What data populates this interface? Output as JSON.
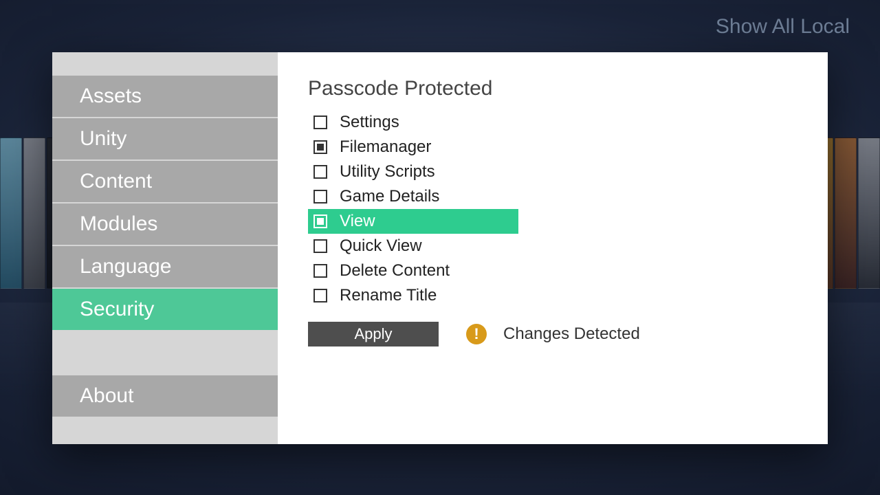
{
  "header": {
    "top_right": "Show All Local"
  },
  "sidebar": {
    "items": [
      {
        "label": "Assets",
        "selected": false
      },
      {
        "label": "Unity",
        "selected": false
      },
      {
        "label": "Content",
        "selected": false
      },
      {
        "label": "Modules",
        "selected": false
      },
      {
        "label": "Language",
        "selected": false
      },
      {
        "label": "Security",
        "selected": true
      }
    ],
    "footer_item": {
      "label": "About",
      "selected": false
    }
  },
  "main": {
    "title": "Passcode Protected",
    "options": [
      {
        "label": "Settings",
        "checked": false,
        "highlighted": false
      },
      {
        "label": "Filemanager",
        "checked": true,
        "highlighted": false
      },
      {
        "label": "Utility Scripts",
        "checked": false,
        "highlighted": false
      },
      {
        "label": "Game Details",
        "checked": false,
        "highlighted": false
      },
      {
        "label": "View",
        "checked": true,
        "highlighted": true
      },
      {
        "label": "Quick View",
        "checked": false,
        "highlighted": false
      },
      {
        "label": "Delete Content",
        "checked": false,
        "highlighted": false
      },
      {
        "label": "Rename Title",
        "checked": false,
        "highlighted": false
      }
    ],
    "apply_label": "Apply",
    "status_icon_glyph": "!",
    "status_text": "Changes Detected"
  },
  "colors": {
    "accent": "#4ec897",
    "highlight": "#2ecc8f",
    "warn": "#d89a1a"
  }
}
